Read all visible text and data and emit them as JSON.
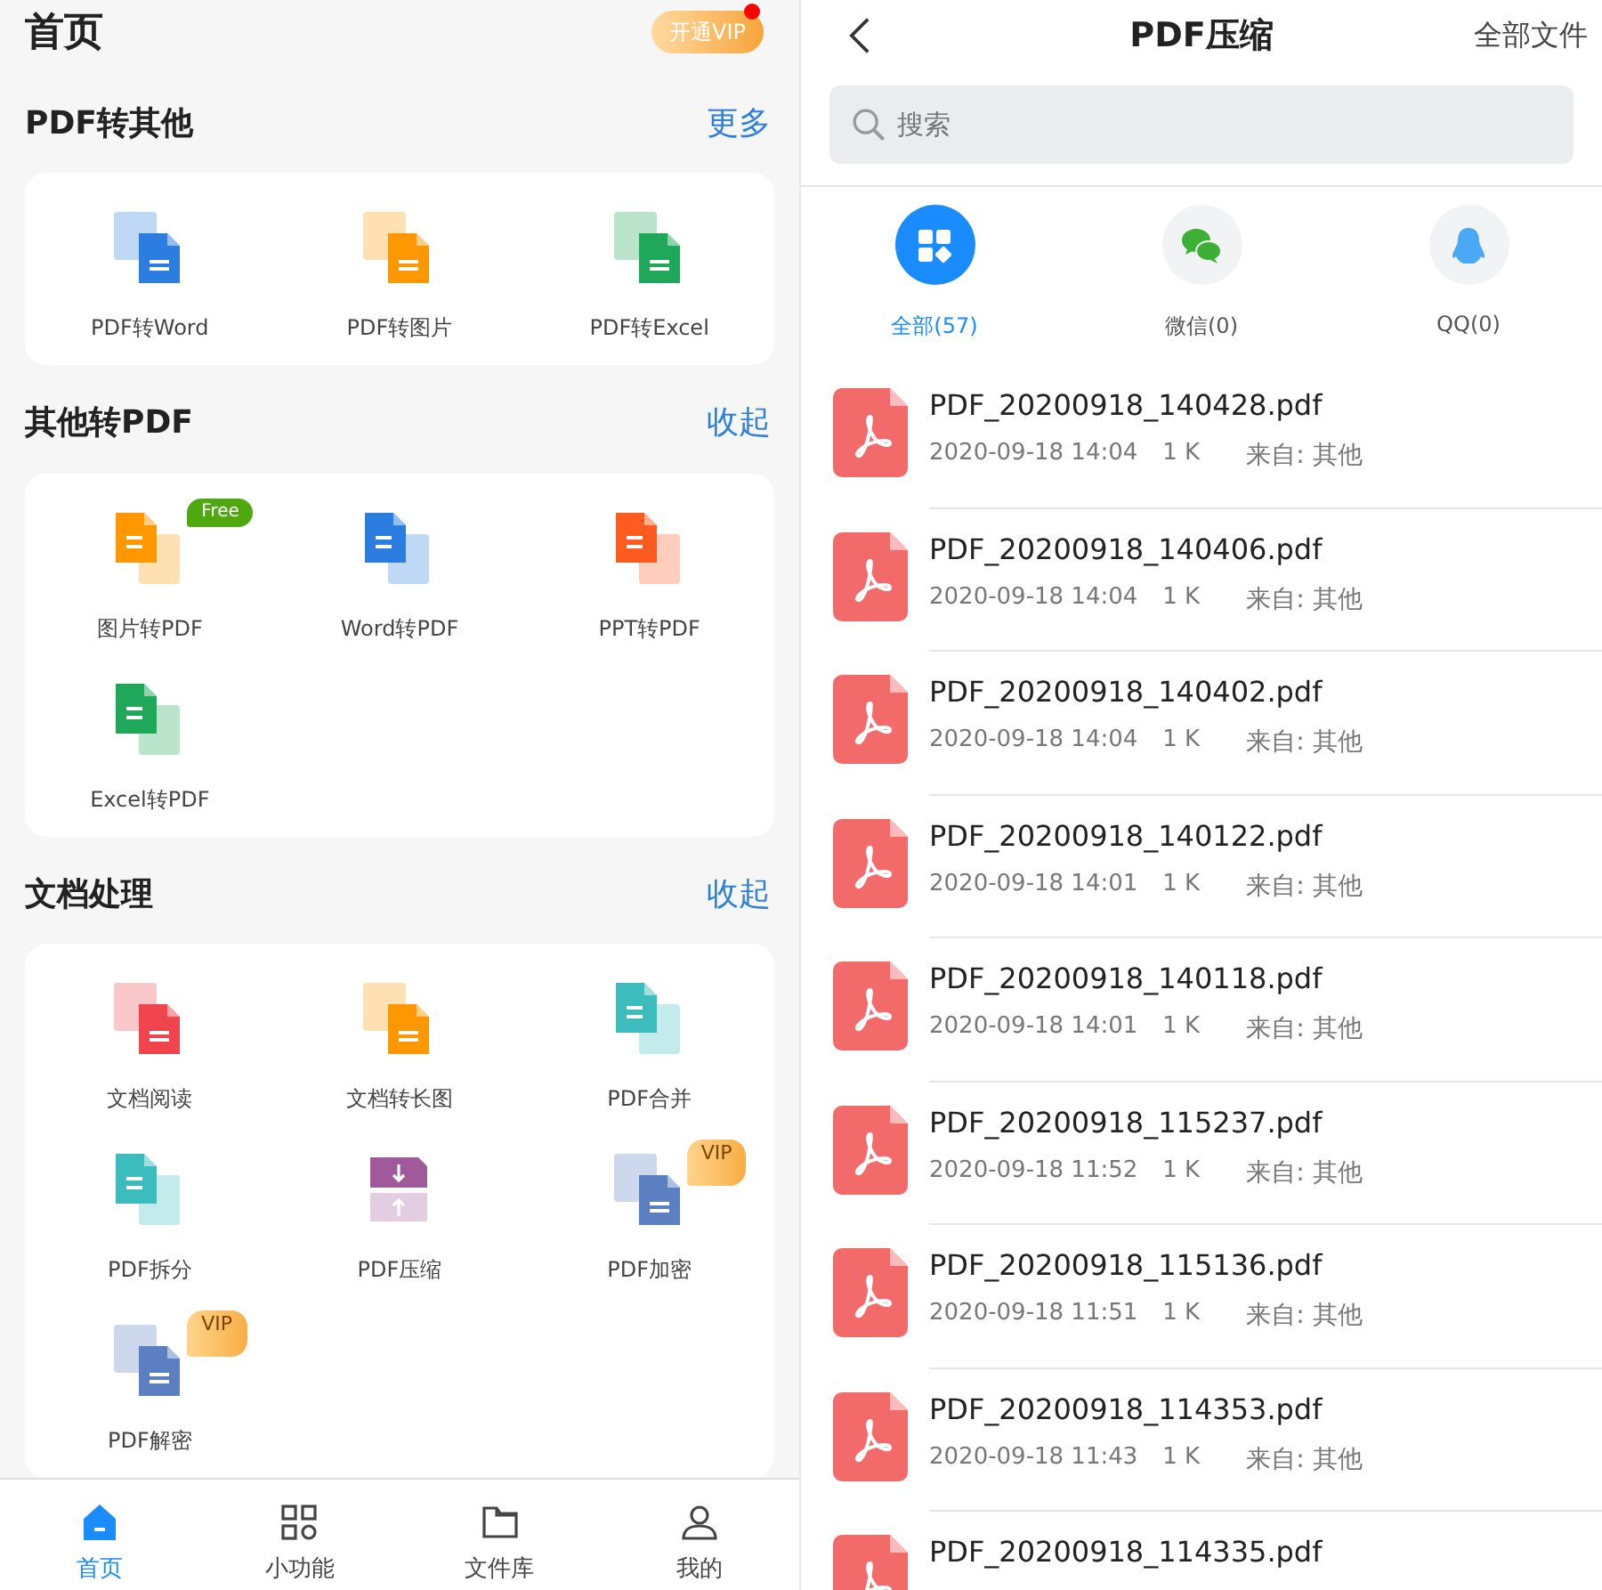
{
  "home": {
    "title": "首页",
    "vip_button": {
      "label": "开通VIP",
      "notification": true
    },
    "sections": [
      {
        "title": "PDF转其他",
        "action": "更多",
        "tools": [
          {
            "label": "PDF转Word",
            "icon": {
              "kind": "export",
              "color": "#2b7de0"
            }
          },
          {
            "label": "PDF转图片",
            "icon": {
              "kind": "export",
              "color": "#ff9800"
            }
          },
          {
            "label": "PDF转Excel",
            "icon": {
              "kind": "export",
              "color": "#1fa75a"
            }
          }
        ]
      },
      {
        "title": "其他转PDF",
        "action": "收起",
        "tools": [
          {
            "label": "图片转PDF",
            "icon": {
              "kind": "import",
              "color": "#ff9800"
            },
            "badge": {
              "text": "Free",
              "kind": "free"
            }
          },
          {
            "label": "Word转PDF",
            "icon": {
              "kind": "import",
              "color": "#2b7de0"
            }
          },
          {
            "label": "PPT转PDF",
            "icon": {
              "kind": "import",
              "color": "#ff5a1f"
            }
          },
          {
            "label": "Excel转PDF",
            "icon": {
              "kind": "import",
              "color": "#1fa75a"
            }
          }
        ]
      },
      {
        "title": "文档处理",
        "action": "收起",
        "tools": [
          {
            "label": "文档阅读",
            "icon": {
              "kind": "export",
              "color": "#f0454f"
            }
          },
          {
            "label": "文档转长图",
            "icon": {
              "kind": "export",
              "color": "#ff9800"
            }
          },
          {
            "label": "PDF合并",
            "icon": {
              "kind": "import",
              "color": "#3cbcbc"
            }
          },
          {
            "label": "PDF拆分",
            "icon": {
              "kind": "import",
              "color": "#3cbcbc"
            }
          },
          {
            "label": "PDF压缩",
            "icon": {
              "kind": "compress",
              "color": "#a05a9c"
            }
          },
          {
            "label": "PDF加密",
            "icon": {
              "kind": "export",
              "color": "#5b7fc0"
            },
            "badge": {
              "text": "VIP",
              "kind": "vip"
            }
          },
          {
            "label": "PDF解密",
            "icon": {
              "kind": "export",
              "color": "#5b7fc0"
            },
            "badge": {
              "text": "VIP",
              "kind": "vip"
            }
          }
        ]
      }
    ],
    "nav": [
      {
        "label": "首页",
        "kind": "home",
        "selected": true
      },
      {
        "label": "小功能",
        "kind": "grid",
        "selected": false
      },
      {
        "label": "文件库",
        "kind": "folder",
        "selected": false
      },
      {
        "label": "我的",
        "kind": "person",
        "selected": false
      }
    ]
  },
  "compress": {
    "title": "PDF压缩",
    "action": "全部文件",
    "search": {
      "placeholder": "搜索"
    },
    "sources": [
      {
        "label": "全部(57)",
        "kind": "all",
        "selected": true
      },
      {
        "label": "微信(0)",
        "kind": "wechat",
        "selected": false
      },
      {
        "label": "QQ(0)",
        "kind": "qq",
        "selected": false
      }
    ],
    "files": [
      {
        "name": "PDF_20200918_140428.pdf",
        "date": "2020-09-18 14:04",
        "size": "1 K",
        "source": "来自: 其他"
      },
      {
        "name": "PDF_20200918_140406.pdf",
        "date": "2020-09-18 14:04",
        "size": "1 K",
        "source": "来自: 其他"
      },
      {
        "name": "PDF_20200918_140402.pdf",
        "date": "2020-09-18 14:04",
        "size": "1 K",
        "source": "来自: 其他"
      },
      {
        "name": "PDF_20200918_140122.pdf",
        "date": "2020-09-18 14:01",
        "size": "1 K",
        "source": "来自: 其他"
      },
      {
        "name": "PDF_20200918_140118.pdf",
        "date": "2020-09-18 14:01",
        "size": "1 K",
        "source": "来自: 其他"
      },
      {
        "name": "PDF_20200918_115237.pdf",
        "date": "2020-09-18 11:52",
        "size": "1 K",
        "source": "来自: 其他"
      },
      {
        "name": "PDF_20200918_115136.pdf",
        "date": "2020-09-18 11:51",
        "size": "1 K",
        "source": "来自: 其他"
      },
      {
        "name": "PDF_20200918_114353.pdf",
        "date": "2020-09-18 11:43",
        "size": "1 K",
        "source": "来自: 其他"
      },
      {
        "name": "PDF_20200918_114335.pdf"
      }
    ]
  }
}
